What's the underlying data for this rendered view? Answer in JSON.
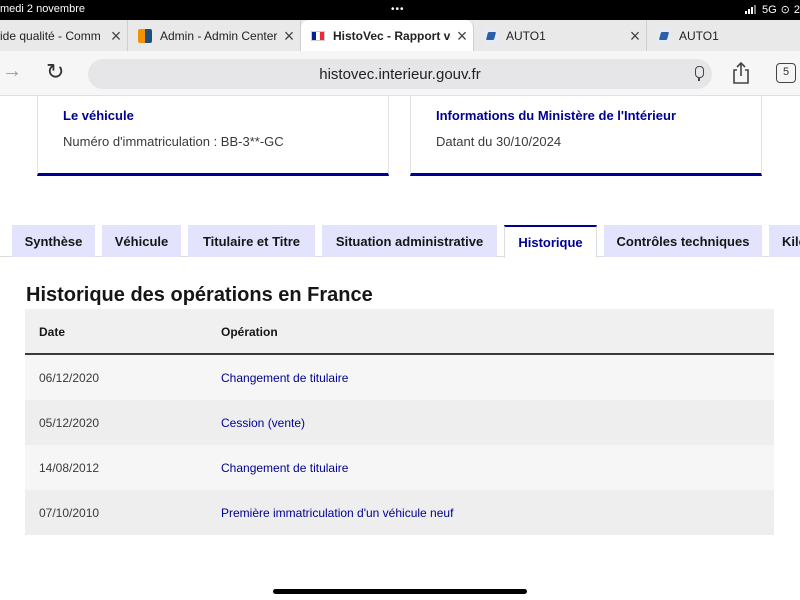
{
  "status_bar": {
    "date": "medi 2 novembre",
    "network": "5G",
    "battery_partial": "2"
  },
  "browser_tabs": [
    {
      "title": "ide qualité - Comm",
      "favicon": "none"
    },
    {
      "title": "Admin - Admin Center",
      "favicon": "admin-center-icon"
    },
    {
      "title": "HistoVec - Rapport ve",
      "favicon": "french-flag-icon",
      "active": true
    },
    {
      "title": "AUTO1",
      "favicon": "auto1-icon"
    },
    {
      "title": "AUTO1",
      "favicon": "auto1-icon"
    }
  ],
  "address_bar": {
    "url": "histovec.interieur.gouv.fr",
    "tab_count": "5"
  },
  "cards": {
    "vehicle": {
      "title": "Le véhicule",
      "text": "Numéro d'immatriculation : BB-3**-GC"
    },
    "ministry": {
      "title": "Informations du Ministère de l'Intérieur",
      "text": "Datant du 30/10/2024"
    }
  },
  "page_tabs": [
    {
      "label": "Synthèse"
    },
    {
      "label": "Véhicule"
    },
    {
      "label": "Titulaire et Titre"
    },
    {
      "label": "Situation administrative"
    },
    {
      "label": "Historique",
      "active": true
    },
    {
      "label": "Contrôles techniques"
    },
    {
      "label": "Kilo"
    }
  ],
  "history": {
    "title": "Historique des opérations en France",
    "columns": {
      "date": "Date",
      "operation": "Opération"
    },
    "rows": [
      {
        "date": "06/12/2020",
        "operation": "Changement de titulaire"
      },
      {
        "date": "05/12/2020",
        "operation": "Cession (vente)"
      },
      {
        "date": "14/08/2012",
        "operation": "Changement de titulaire"
      },
      {
        "date": "07/10/2010",
        "operation": "Première immatriculation d'un véhicule neuf"
      }
    ]
  },
  "colors": {
    "accent": "#000091",
    "tab_bg": "#e3e3fd"
  }
}
